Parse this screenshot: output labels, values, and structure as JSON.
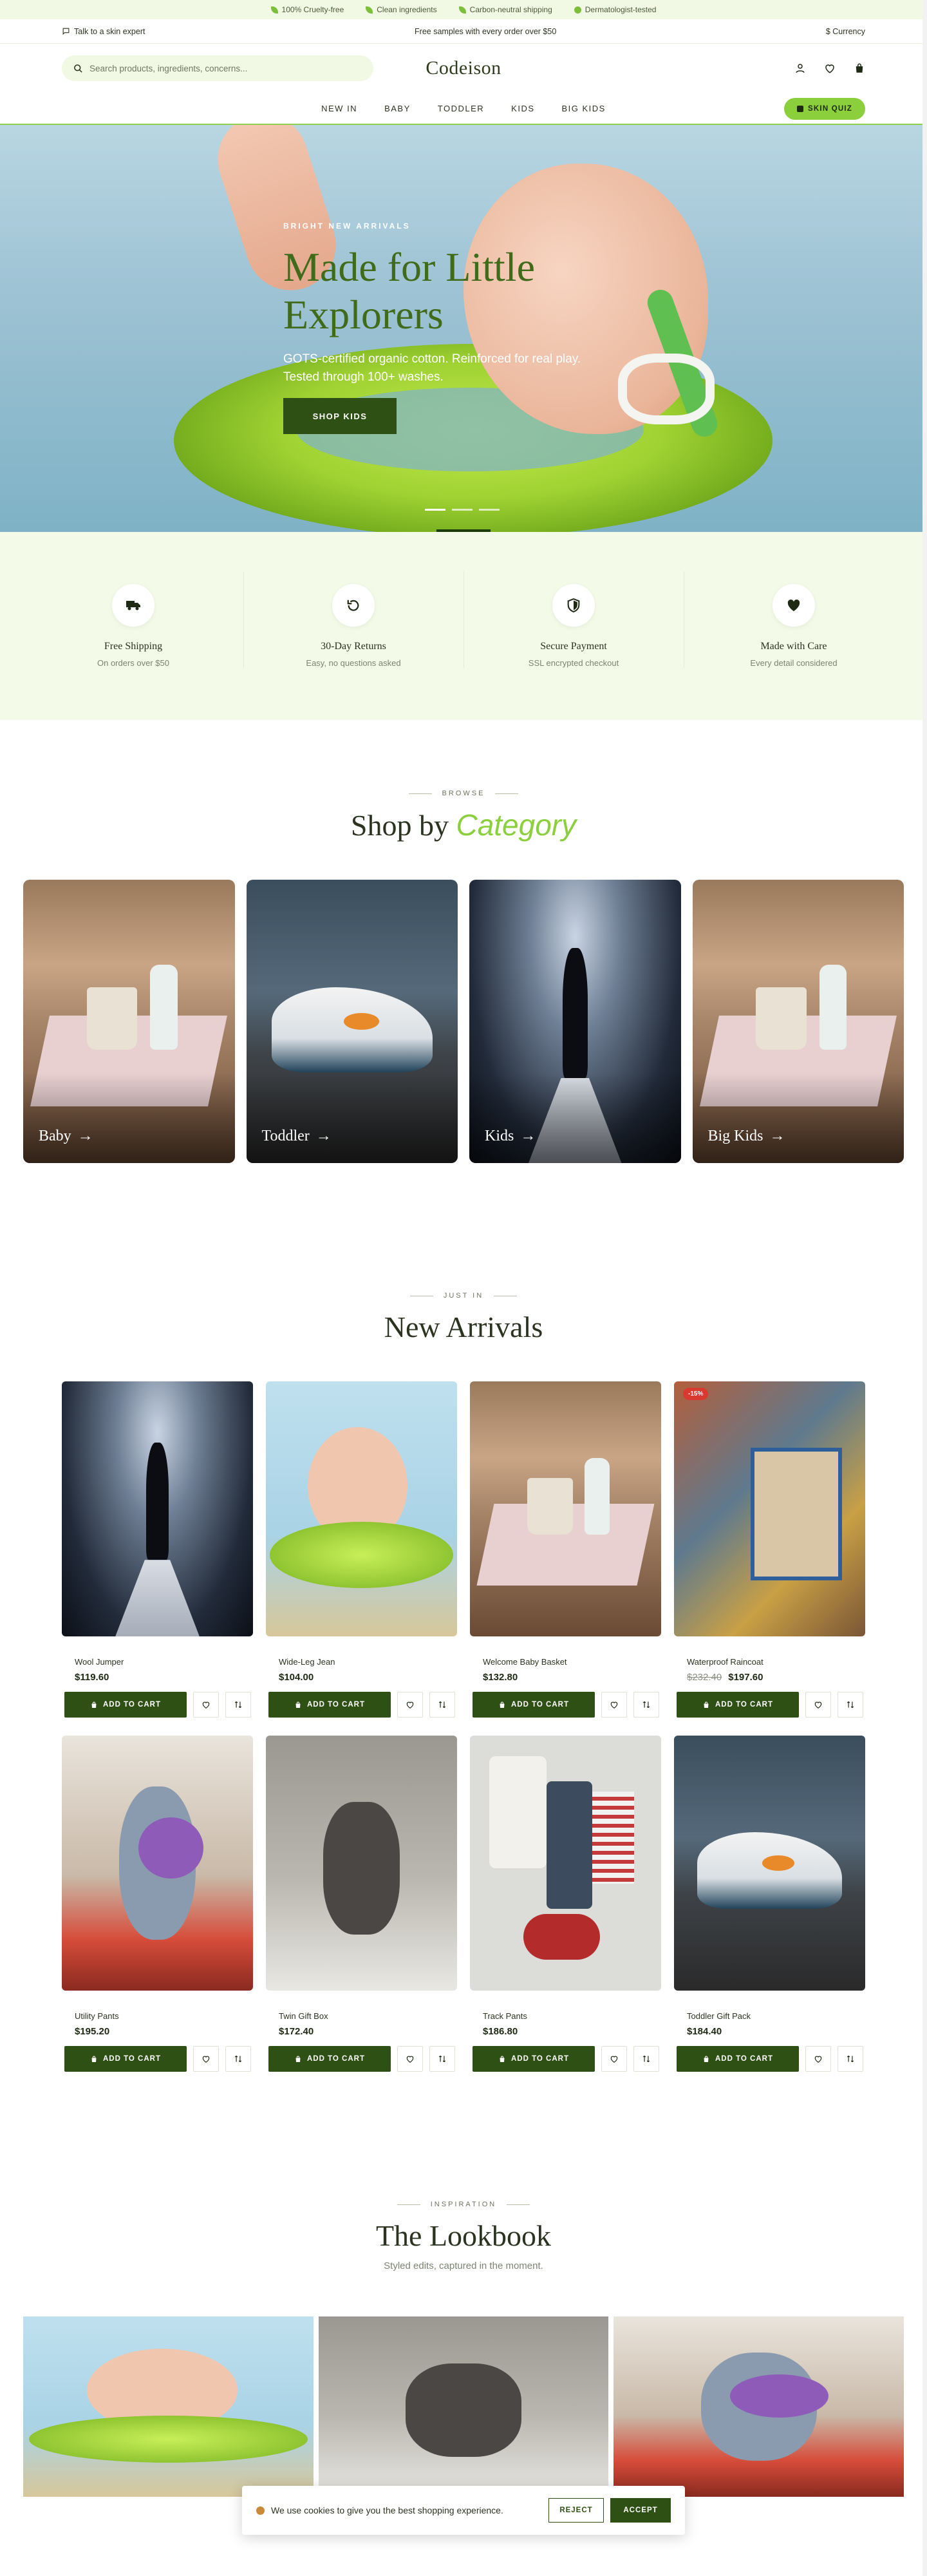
{
  "topbar": {
    "items": [
      "100% Cruelty-free",
      "Clean ingredients",
      "Carbon-neutral shipping",
      "Dermatologist-tested"
    ]
  },
  "subbar": {
    "expert": "Talk to a skin expert",
    "promo": "Free samples with every order over $50",
    "currency": "$ Currency"
  },
  "header": {
    "search_placeholder": "Search products, ingredients, concerns...",
    "logo": "Codeison"
  },
  "nav": {
    "items": [
      "NEW IN",
      "BABY",
      "TODDLER",
      "KIDS",
      "BIG KIDS"
    ],
    "quiz": "SKIN QUIZ"
  },
  "hero": {
    "eyebrow": "BRIGHT NEW ARRIVALS",
    "title": "Made for Little Explorers",
    "text": "GOTS-certified organic cotton. Reinforced for real play. Tested through 100+ washes.",
    "cta": "SHOP KIDS"
  },
  "features": [
    {
      "title": "Free Shipping",
      "sub": "On orders over $50",
      "icon": "truck-icon"
    },
    {
      "title": "30-Day Returns",
      "sub": "Easy, no questions asked",
      "icon": "return-icon"
    },
    {
      "title": "Secure Payment",
      "sub": "SSL encrypted checkout",
      "icon": "shield-icon"
    },
    {
      "title": "Made with Care",
      "sub": "Every detail considered",
      "icon": "heart-icon"
    }
  ],
  "categories": {
    "eyebrow": "BROWSE",
    "title_main": "Shop by",
    "title_accent": "Category",
    "items": [
      "Baby",
      "Toddler",
      "Kids",
      "Big Kids"
    ],
    "arrow": "→"
  },
  "arrivals": {
    "eyebrow": "JUST IN",
    "title": "New Arrivals",
    "atc": "ADD TO CART",
    "products": [
      {
        "name": "Wool Jumper",
        "price": "$119.60",
        "old": "",
        "badge": ""
      },
      {
        "name": "Wide-Leg Jean",
        "price": "$104.00",
        "old": "",
        "badge": ""
      },
      {
        "name": "Welcome Baby Basket",
        "price": "$132.80",
        "old": "",
        "badge": ""
      },
      {
        "name": "Waterproof Raincoat",
        "price": "$197.60",
        "old": "$232.40",
        "badge": "-15%"
      },
      {
        "name": "Utility Pants",
        "price": "$195.20",
        "old": "",
        "badge": ""
      },
      {
        "name": "Twin Gift Box",
        "price": "$172.40",
        "old": "",
        "badge": ""
      },
      {
        "name": "Track Pants",
        "price": "$186.80",
        "old": "",
        "badge": ""
      },
      {
        "name": "Toddler Gift Pack",
        "price": "$184.40",
        "old": "",
        "badge": ""
      }
    ]
  },
  "lookbook": {
    "eyebrow": "INSPIRATION",
    "title": "The Lookbook",
    "sub": "Styled edits, captured in the moment."
  },
  "cookie": {
    "text": "We use cookies to give you the best shopping experience.",
    "reject": "REJECT",
    "accept": "ACCEPT"
  },
  "colors": {
    "accent": "#8bcf3d",
    "primary": "#2f5014",
    "sale": "#d93a2f"
  }
}
